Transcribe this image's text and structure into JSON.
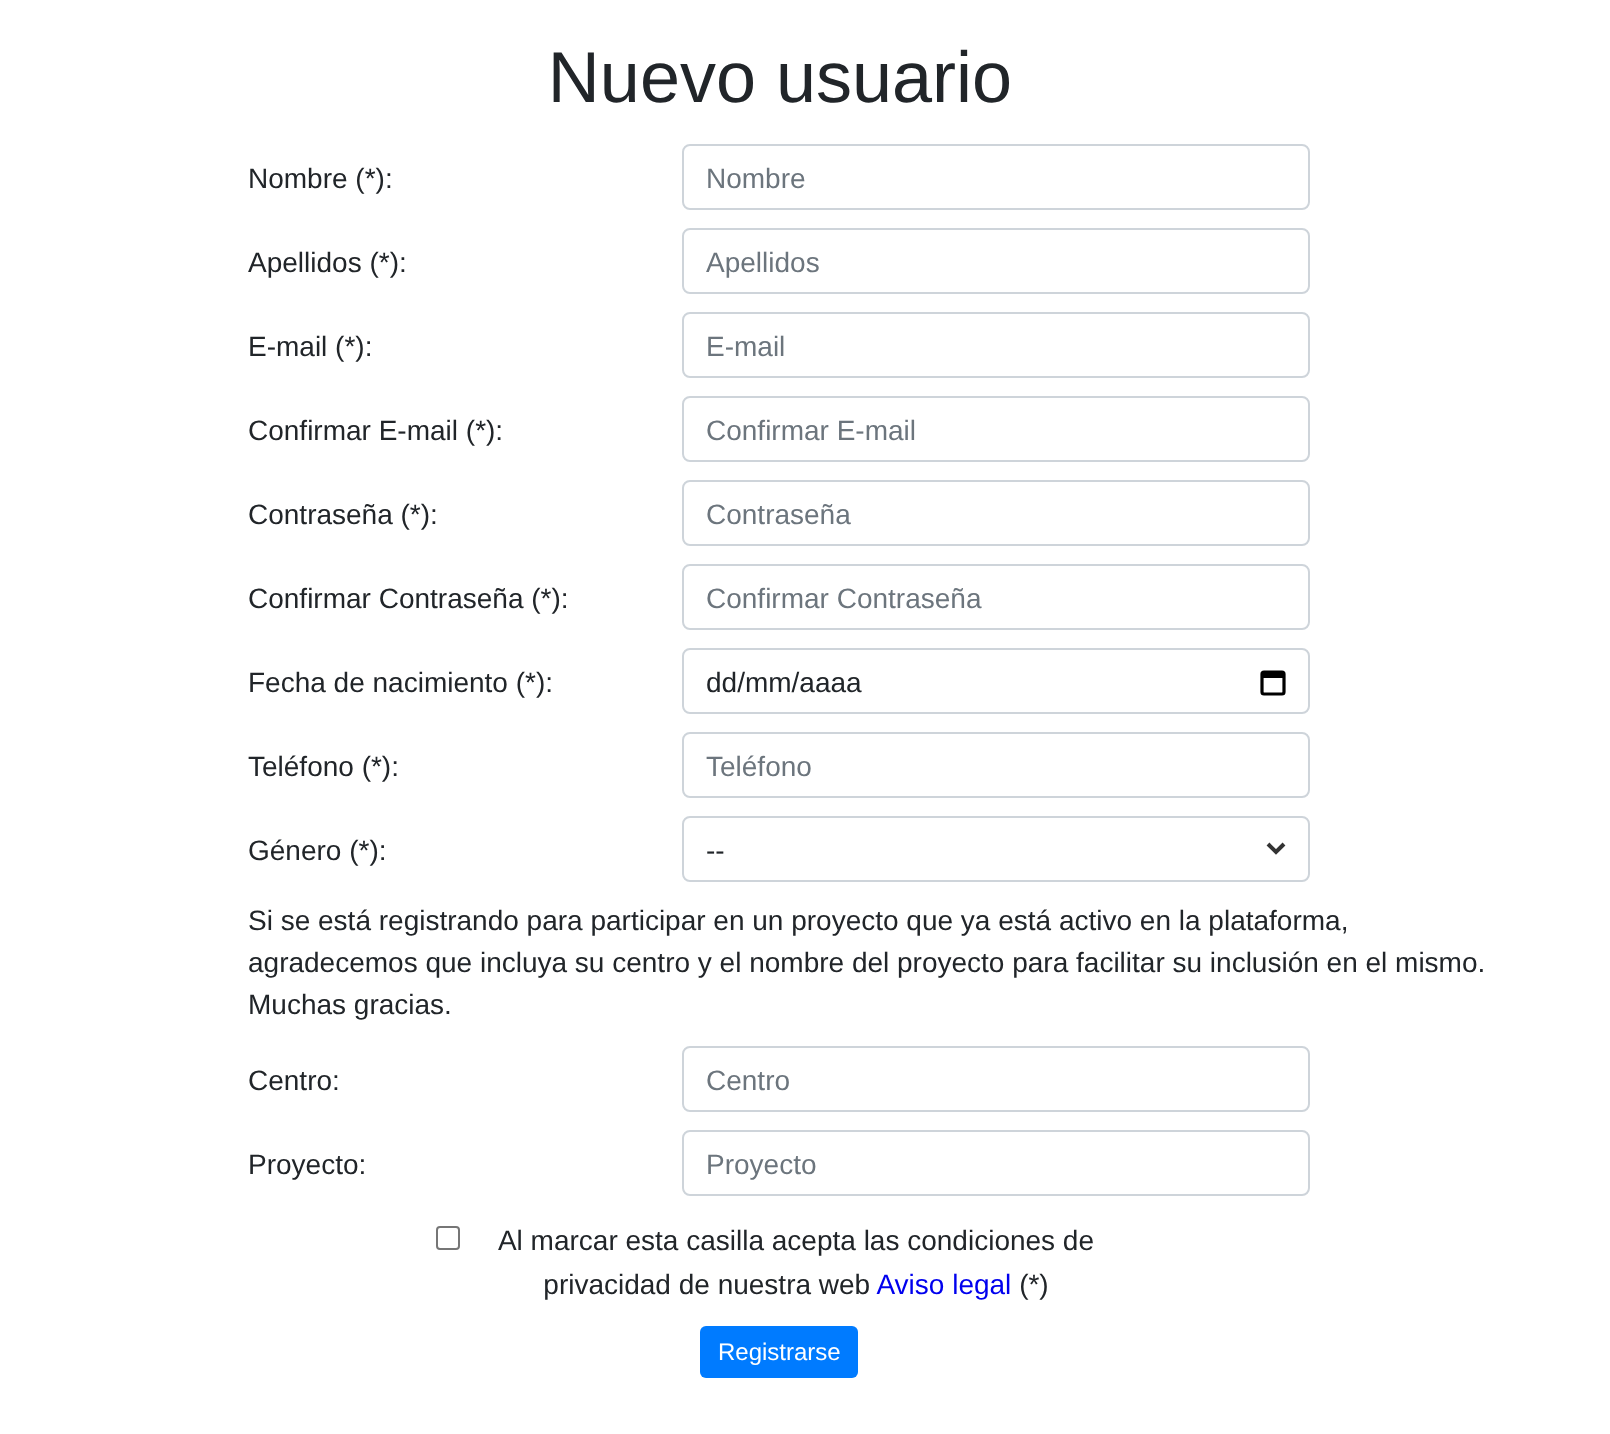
{
  "title": "Nuevo usuario",
  "fields": [
    {
      "label": "Nombre (*):",
      "kind": "text",
      "placeholder": "Nombre"
    },
    {
      "label": "Apellidos (*):",
      "kind": "text",
      "placeholder": "Apellidos"
    },
    {
      "label": "E-mail (*):",
      "kind": "text",
      "placeholder": "E-mail"
    },
    {
      "label": "Confirmar E-mail (*):",
      "kind": "text",
      "placeholder": "Confirmar E-mail"
    },
    {
      "label": "Contraseña (*):",
      "kind": "text",
      "placeholder": "Contraseña"
    },
    {
      "label": "Confirmar Contraseña (*):",
      "kind": "text",
      "placeholder": "Confirmar Contraseña"
    },
    {
      "label": "Fecha de nacimiento (*):",
      "kind": "date",
      "value": "dd/mm/aaaa"
    },
    {
      "label": "Teléfono (*):",
      "kind": "text",
      "placeholder": "Teléfono"
    },
    {
      "label": "Género (*):",
      "kind": "select",
      "value": "--"
    }
  ],
  "note": "Si se está registrando para participar en un proyecto que ya está activo en la plataforma, agradecemos que incluya su centro y el nombre del proyecto para facilitar su inclusión en el mismo. Muchas gracias.",
  "extra_fields": [
    {
      "label": "Centro:",
      "kind": "text",
      "placeholder": "Centro"
    },
    {
      "label": "Proyecto:",
      "kind": "text",
      "placeholder": "Proyecto"
    }
  ],
  "consent": {
    "checked": false,
    "text": "Al marcar esta casilla acepta las condiciones de privacidad de nuestra web",
    "link": "Aviso legal",
    "suffix": "(*)"
  },
  "submit": "Registrarse"
}
